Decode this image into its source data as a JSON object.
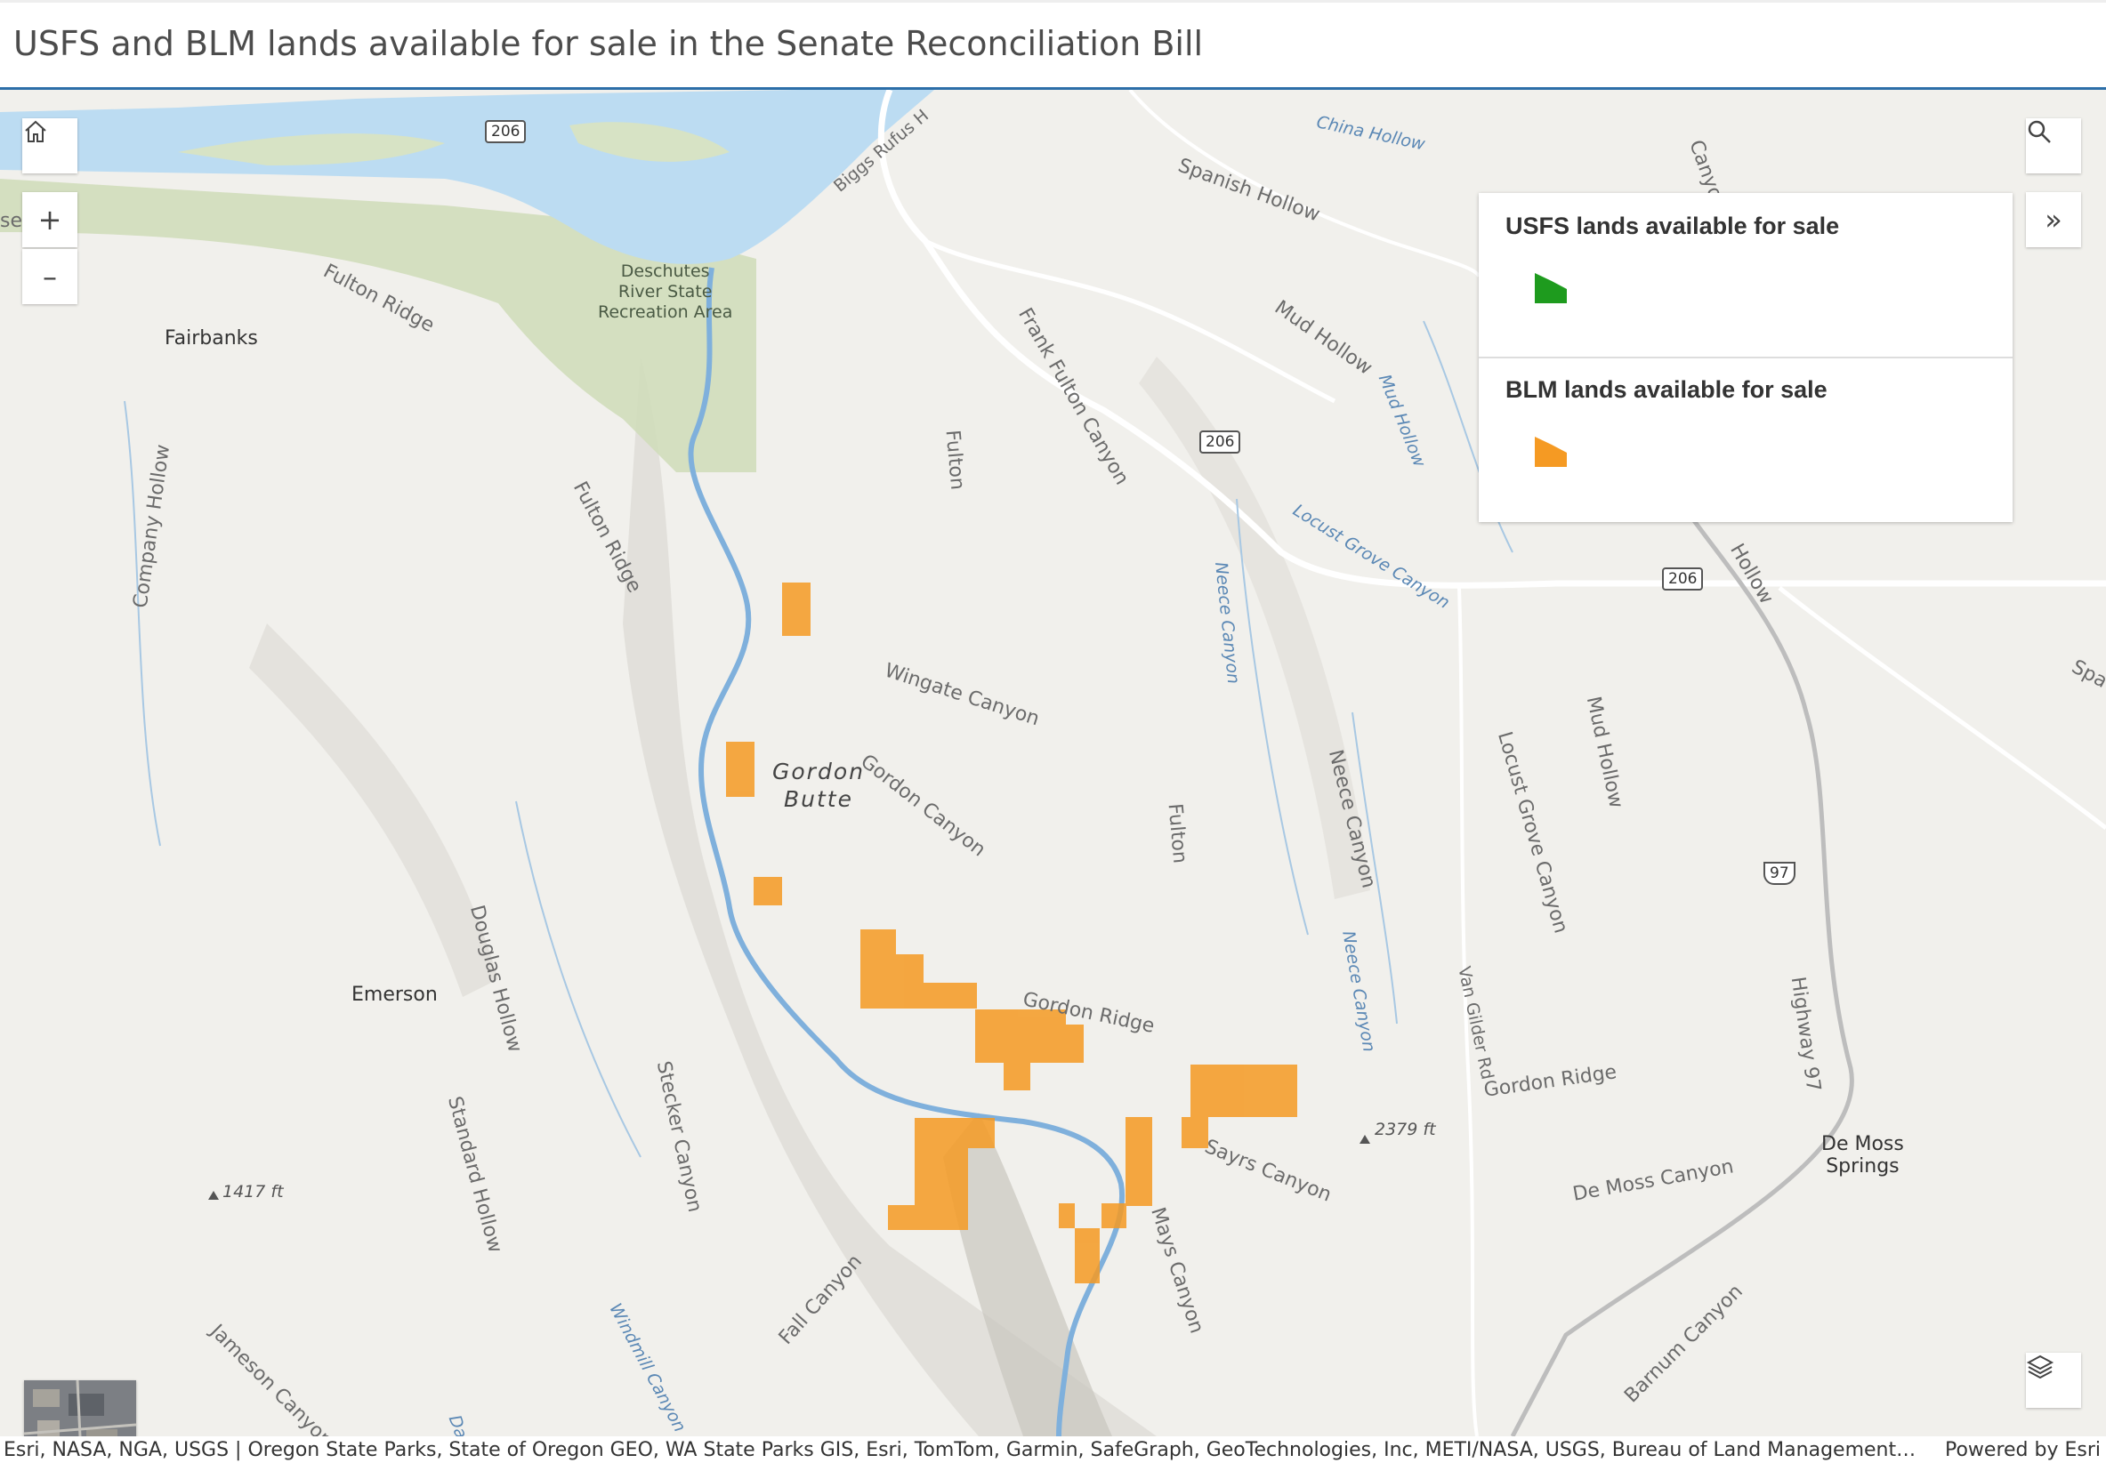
{
  "header": {
    "title": "USFS and BLM lands available for sale in the Senate Reconciliation Bill"
  },
  "colors": {
    "usfs": "#1e9b1e",
    "blm": "#f59a23",
    "header_border": "#2c6ea8",
    "river": "#bcdcf2",
    "park": "#cfdcb8"
  },
  "controls": {
    "home_icon": "home-icon",
    "zoom_in": "+",
    "zoom_out": "–",
    "search_icon": "search-icon",
    "collapse": "»",
    "layers_icon": "layers-icon"
  },
  "legend": {
    "items": [
      {
        "title": "USFS lands available for sale",
        "color": "#1e9b1e"
      },
      {
        "title": "BLM lands available for sale",
        "color": "#f59a23"
      }
    ]
  },
  "map": {
    "places": {
      "fairbanks": "Fairbanks",
      "emerson": "Emerson",
      "de_moss": "De Moss\nSprings"
    },
    "features": {
      "gordon_butte": "Gordon\nButte"
    },
    "park": "Deschutes\nRiver State\nRecreation Area",
    "labels": {
      "fulton_ridge_1": "Fulton Ridge",
      "fulton_ridge_2": "Fulton Ridge",
      "company_hollow": "Company Hollow",
      "douglas_hollow": "Douglas Hollow",
      "standard_hollow": "Standard Hollow",
      "stecker_canyon": "Stecker Canyon",
      "jameson_canyon": "Jameson Canyon",
      "fall_canyon": "Fall Canyon",
      "mays_canyon": "Mays Canyon",
      "sayrs_canyon": "Sayrs Canyon",
      "gordon_ridge_1": "Gordon Ridge",
      "gordon_ridge_2": "Gordon Ridge",
      "gordon_canyon": "Gordon Canyon",
      "wingate_canyon": "Wingate Canyon",
      "fulton_1": "Fulton",
      "fulton_2": "Fulton",
      "frank_fulton": "Frank Fulton Canyon",
      "spanish_hollow": "Spanish Hollow",
      "mud_hollow_1": "Mud Hollow",
      "mud_hollow_3": "Mud Hollow",
      "neece_canyon_1": "Neece Canyon",
      "locust_grove": "Locust Grove Canyon",
      "van_gilder": "Van Gilder Rd",
      "highway_97": "Highway 97",
      "de_moss_canyon": "De Moss Canyon",
      "barnum_canyon": "Barnum Canyon",
      "biggs_rufus": "Biggs Rufus H",
      "canyon_top": "Canyon",
      "hollow_right": "Hollow",
      "spa_right": "Spa",
      "sen_ridge": "ser  ge"
    },
    "water_labels": {
      "china_hollow": "China Hollow",
      "mud_hollow_2": "Mud Hollow",
      "locust_grove_canyon": "Locust Grove Canyon",
      "neece_canyon_2": "Neece Canyon",
      "neece_canyon_3": "Neece Canyon",
      "windmill_canyon": "Windmill Canyon",
      "davis_cr": "Davis Cr"
    },
    "elevations": {
      "e1417": "1417 ft",
      "e2379": "2379 ft"
    },
    "shields": {
      "r206_a": "206",
      "r206_b": "206",
      "r206_c": "206",
      "us97": "97"
    }
  },
  "attribution": {
    "text": "Esri, NASA, NGA, USGS | Oregon State Parks, State of Oregon GEO, WA State Parks GIS, Esri, TomTom, Garmin, SafeGraph, GeoTechnologies, Inc, METI/NASA, USGS, Bureau of Land Management, E…",
    "powered": "Powered by Esri"
  }
}
